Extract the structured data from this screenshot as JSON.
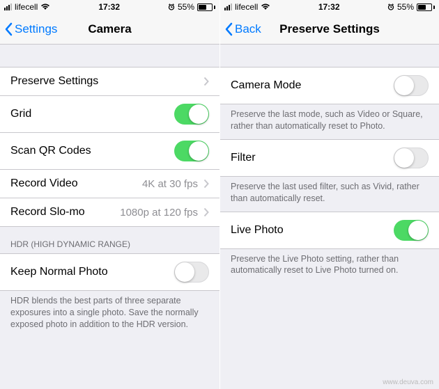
{
  "left": {
    "status": {
      "carrier": "lifecell",
      "time": "17:32",
      "battery": "55%"
    },
    "nav": {
      "back": "Settings",
      "title": "Camera"
    },
    "rows": {
      "preserve": "Preserve Settings",
      "grid": "Grid",
      "qrcodes": "Scan QR Codes",
      "record_video": {
        "label": "Record Video",
        "value": "4K at 30 fps"
      },
      "record_slomo": {
        "label": "Record Slo-mo",
        "value": "1080p at 120 fps"
      }
    },
    "hdr": {
      "header": "HDR (HIGH DYNAMIC RANGE)",
      "keep_normal": "Keep Normal Photo",
      "footer": "HDR blends the best parts of three separate exposures into a single photo. Save the normally exposed photo in addition to the HDR version."
    },
    "toggles": {
      "grid": true,
      "qrcodes": true,
      "keep_normal": false
    }
  },
  "right": {
    "status": {
      "carrier": "lifecell",
      "time": "17:32",
      "battery": "55%"
    },
    "nav": {
      "back": "Back",
      "title": "Preserve Settings"
    },
    "camera_mode": {
      "label": "Camera Mode",
      "footer": "Preserve the last mode, such as Video or Square, rather than automatically reset to Photo.",
      "on": false
    },
    "filter": {
      "label": "Filter",
      "footer": "Preserve the last used filter, such as Vivid, rather than automatically reset.",
      "on": false
    },
    "live_photo": {
      "label": "Live Photo",
      "footer": "Preserve the Live Photo setting, rather than automatically reset to Live Photo turned on.",
      "on": true
    }
  },
  "watermark": "www.deuva.com"
}
